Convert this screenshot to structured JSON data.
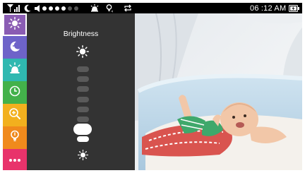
{
  "status_bar": {
    "signal_icon": "signal-strength-icon",
    "night_mode_icon": "moon-icon",
    "volume_icon": "speaker-icon",
    "volume_level": 4,
    "volume_max": 6,
    "alarm_icon": "alarm-icon",
    "temp_icon": "thermometer-icon",
    "loop_icon": "repeat-icon",
    "time": "06 :12 AM",
    "battery_icon": "battery-charging-icon"
  },
  "sidebar": {
    "items": [
      {
        "name": "brightness",
        "icon": "sun-icon",
        "color": "#8a5cb3",
        "active": true
      },
      {
        "name": "lullaby",
        "icon": "moon-icon",
        "color": "#6e63c9"
      },
      {
        "name": "alarm",
        "icon": "alarm-icon",
        "color": "#2fb8b0"
      },
      {
        "name": "timer",
        "icon": "clock-icon",
        "color": "#43b14a"
      },
      {
        "name": "zoom",
        "icon": "zoom-in-icon",
        "color": "#f2b01e"
      },
      {
        "name": "temperature",
        "icon": "thermometer-icon",
        "color": "#f08a1c"
      },
      {
        "name": "more",
        "icon": "more-icon",
        "color": "#e8336b"
      }
    ]
  },
  "brightness_panel": {
    "title": "Brightness",
    "levels": 8,
    "current_level": 2,
    "max_icon": "sun-icon",
    "min_icon": "sun-small-icon"
  }
}
